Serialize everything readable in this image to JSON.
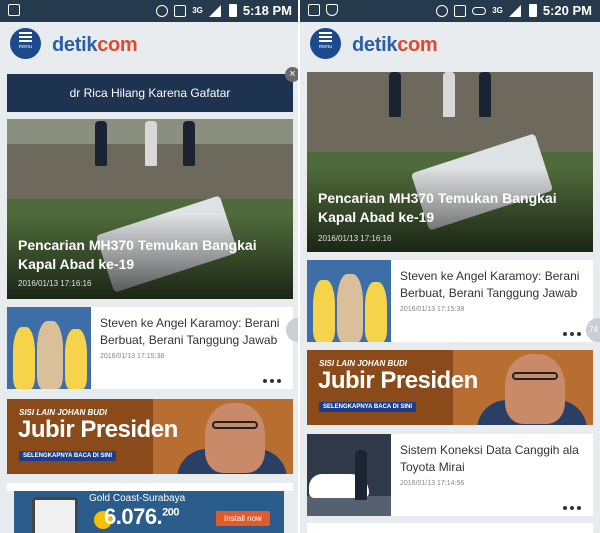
{
  "left": {
    "status": {
      "time": "5:18 PM",
      "network": "3G"
    },
    "header": {
      "menu_label": "menu",
      "logo_part1": "detik",
      "logo_part2": "com"
    },
    "notification": {
      "text": "dr Rica Hilang Karena Gafatar",
      "close": "×"
    },
    "hero": {
      "title": "Pencarian MH370 Temukan Bangkai Kapal Abad ke-19",
      "time": "2016/01/13 17:16:16"
    },
    "card1": {
      "title": "Steven ke Angel Karamoy: Berani Berbuat, Berani Tanggung Jawab",
      "time": "2016/01/13 17:15:38"
    },
    "ad": {
      "kicker": "SISI LAIN JOHAN BUDI",
      "headline": "Jubir Presiden",
      "cta": "SELENGKAPNYA BACA DI SINI"
    },
    "bottom_ad": {
      "route": "Gold Coast-Surabaya",
      "price": "6.076.",
      "price_sup": "200",
      "install": "Install now"
    }
  },
  "right": {
    "status": {
      "time": "5:20 PM",
      "network": "3G"
    },
    "header": {
      "menu_label": "menu",
      "logo_part1": "detik",
      "logo_part2": "com"
    },
    "hero": {
      "title": "Pencarian MH370 Temukan Bangkai Kapal Abad ke-19",
      "time": "2016/01/13 17:16:16"
    },
    "card1": {
      "title": "Steven ke Angel Karamoy: Berani Berbuat, Berani Tanggung Jawab",
      "time": "2016/01/13 17:15:38"
    },
    "ad": {
      "kicker": "SISI LAIN JOHAN BUDI",
      "headline": "Jubir Presiden",
      "cta": "SELENGKAPNYA BACA DI SINI"
    },
    "card2": {
      "title": "Sistem Koneksi Data Canggih ala Toyota Mirai",
      "time": "2016/01/13 17:14:56"
    },
    "pager": "74"
  },
  "colors": {
    "status_bar": "#263a4d",
    "brand_blue": "#1d4a8a",
    "logo_accent": "#e2472f",
    "notification": "#1e3350"
  }
}
